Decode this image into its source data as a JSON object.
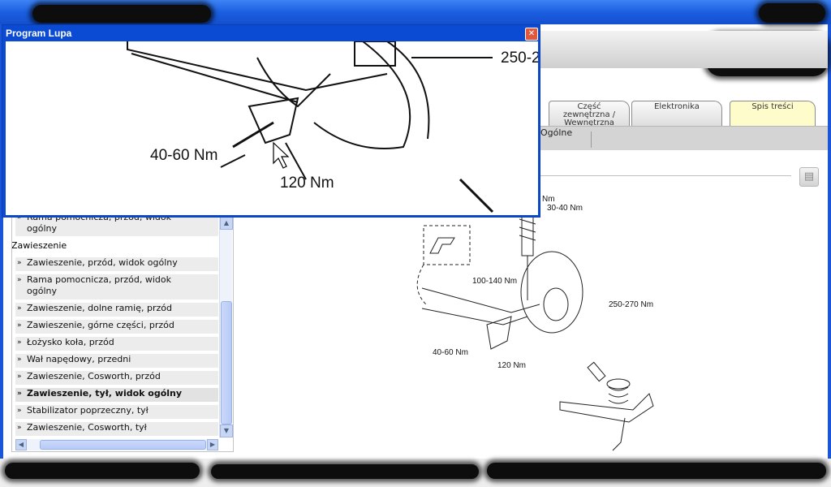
{
  "magnifier": {
    "title": "Program Lupa",
    "close_glyph": "✕",
    "labels": {
      "top_torque": "250-2",
      "left_torque": "40-60 Nm",
      "bottom_torque": "120 Nm"
    }
  },
  "tabs": [
    {
      "line1": "Część",
      "line2": "zewnętrzna /",
      "line3": "Wewnętrzna"
    },
    {
      "line1": "Elektronika"
    },
    {
      "line1": "Spis treści"
    }
  ],
  "subbar": {
    "label": "Ogólne"
  },
  "sidebar": {
    "partial_row": {
      "line1": "Rama pomocnicza, przód, widok",
      "line2": "ogólny"
    },
    "section_header": "Zawieszenie",
    "items": [
      {
        "label": "Zawieszenie, przód, widok ogólny"
      },
      {
        "label": "Rama pomocnicza, przód, widok ogólny"
      },
      {
        "label": "Zawieszenie, dolne ramię, przód"
      },
      {
        "label": "Zawieszenie, górne części, przód"
      },
      {
        "label": "Łożysko koła, przód"
      },
      {
        "label": "Wał napędowy, przedni"
      },
      {
        "label": "Zawieszenie, Cosworth, przód"
      },
      {
        "label": "Zawieszenie, tył, widok ogólny",
        "selected": true
      },
      {
        "label": "Stabilizator poprzeczny, tył"
      },
      {
        "label": "Zawieszenie, Cosworth, tył"
      }
    ]
  },
  "diagram": {
    "labels": {
      "nm_top": "Nm",
      "shock_top": "30-40 Nm",
      "upper_arm": "100-140 Nm",
      "hub": "250-270 Nm",
      "lower_left": "40-60 Nm",
      "lower_bottom": "120 Nm"
    }
  },
  "colors": {
    "titlebar": "#1b5fe0",
    "active_tab": "#fffccc",
    "scrollbar": "#c8d6f5"
  }
}
